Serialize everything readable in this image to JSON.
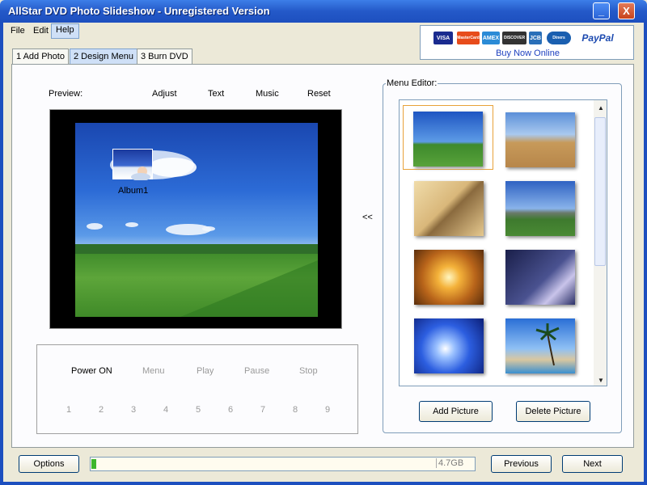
{
  "window": {
    "title": "AllStar DVD Photo Slideshow  - Unregistered Version",
    "minimize_glyph": "_",
    "close_glyph": "X"
  },
  "menu": [
    "File",
    "Edit",
    "Help"
  ],
  "payment": {
    "cards": [
      "VISA",
      "MasterCard",
      "AMEX",
      "DISCOVER",
      "JCB",
      "Diners",
      "PayPal"
    ],
    "buy_label": "Buy Now Online"
  },
  "tabs": [
    "1 Add Photo",
    "2 Design Menu",
    "3 Burn DVD"
  ],
  "preview": {
    "label": "Preview:",
    "actions": [
      "Adjust",
      "Text",
      "Music",
      "Reset"
    ],
    "album_label": "Album1"
  },
  "remote": {
    "buttons": [
      "Power ON",
      "Menu",
      "Play",
      "Pause",
      "Stop"
    ],
    "numbers": [
      "1",
      "2",
      "3",
      "4",
      "5",
      "6",
      "7",
      "8",
      "9"
    ]
  },
  "move_left_label": "<<",
  "menu_editor": {
    "title": "Menu Editor:",
    "thumbnails": [
      "green-field-sky",
      "wheat-field-path",
      "sand-dune-plant",
      "stonehenge",
      "golden-sunset",
      "lightning-storm",
      "blue-light-burst",
      "palm-tree-beach"
    ],
    "add_label": "Add Picture",
    "delete_label": "Delete Picture"
  },
  "bottom": {
    "options_label": "Options",
    "capacity_label": "4.7GB",
    "progress": 0.01,
    "previous_label": "Previous",
    "next_label": "Next"
  },
  "colors": {
    "titlebar": "#2459c8",
    "selection": "#e8a23a",
    "progress": "#3cb62c"
  }
}
